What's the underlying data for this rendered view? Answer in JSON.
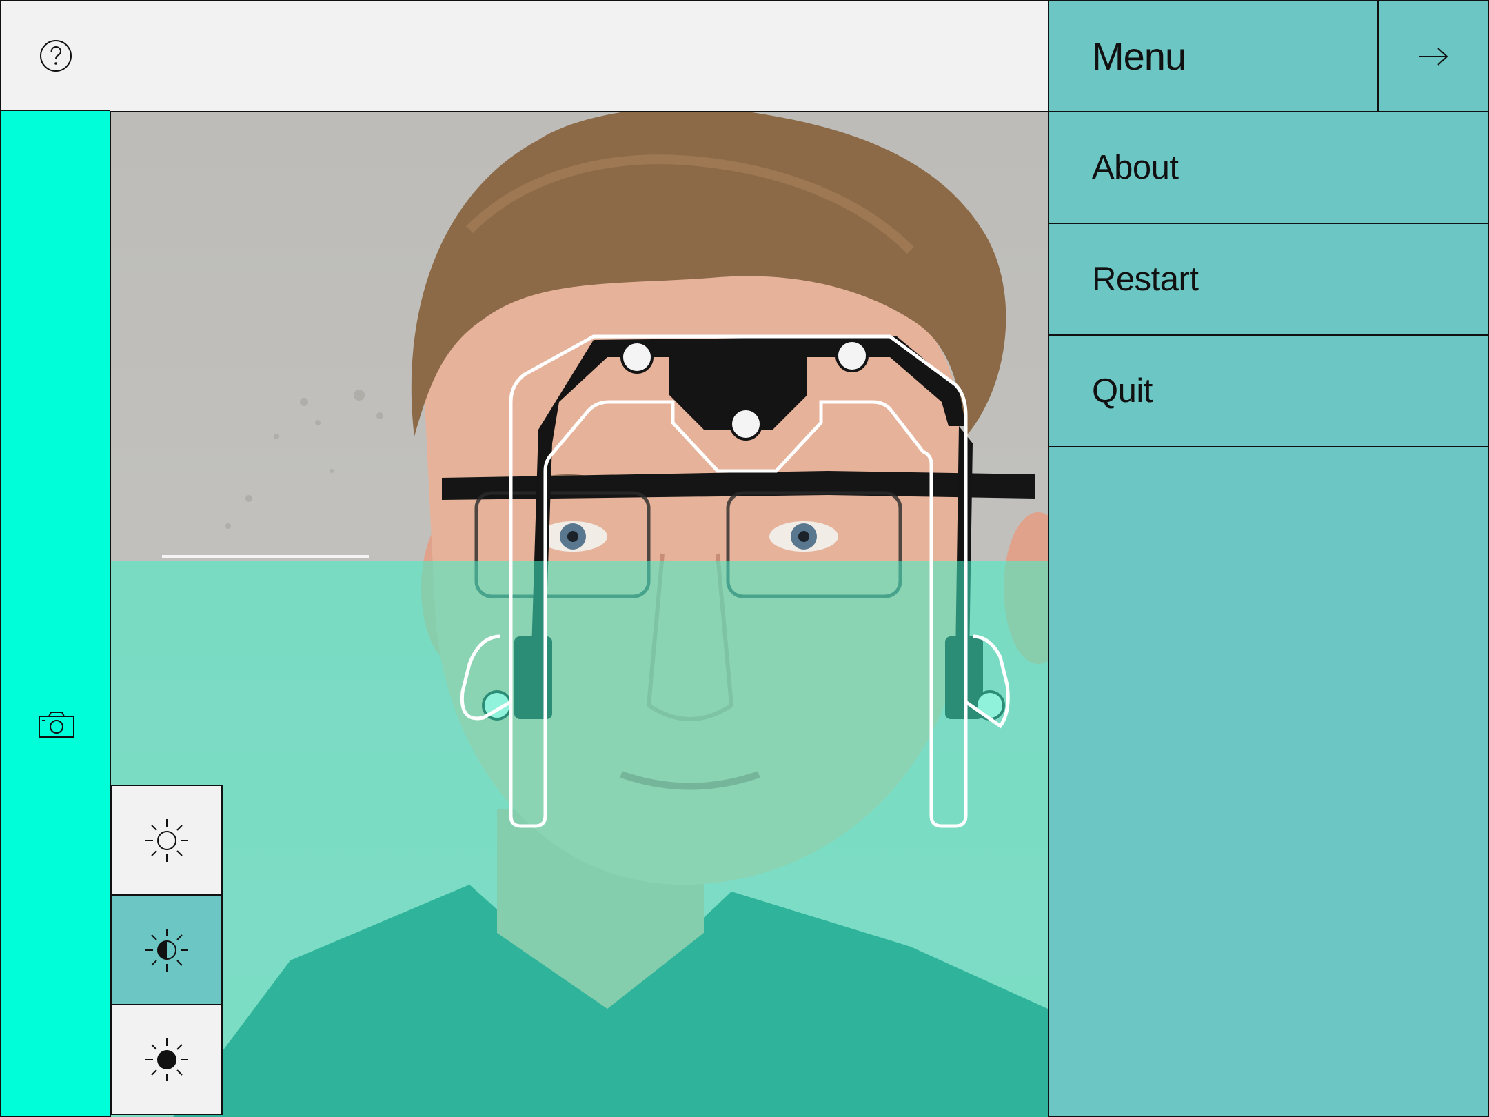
{
  "app": {
    "help_icon": "question-circle-icon",
    "camera_icon": "camera-icon"
  },
  "brightness": {
    "options": [
      {
        "id": "low",
        "icon": "sun-outline-icon"
      },
      {
        "id": "medium",
        "icon": "sun-half-icon",
        "selected": true
      },
      {
        "id": "high",
        "icon": "sun-filled-icon"
      }
    ]
  },
  "menu": {
    "title": "Menu",
    "close_icon": "arrow-right-icon",
    "items": [
      {
        "label": "About"
      },
      {
        "label": "Restart"
      },
      {
        "label": "Quit"
      }
    ]
  },
  "colors": {
    "rail_accent": "#00ffd9",
    "menu_bg": "#6cc6c4",
    "overlay_tint": "#3ff0c8"
  }
}
